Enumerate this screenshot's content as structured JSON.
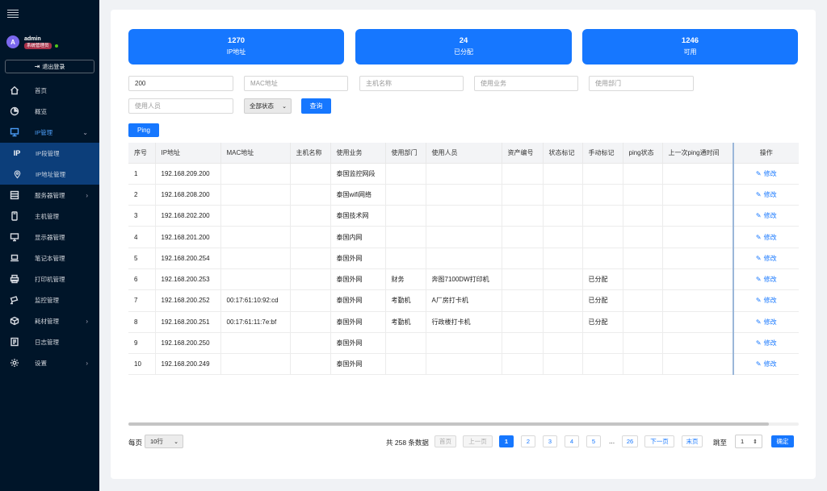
{
  "sidebar": {
    "user": {
      "initial": "A",
      "name": "admin",
      "role": "系统管理员"
    },
    "logout_label": "退出登录",
    "items": [
      {
        "label": "首页",
        "icon": "home-icon"
      },
      {
        "label": "概览",
        "icon": "pie-chart-icon"
      },
      {
        "label": "IP管理",
        "icon": "monitor-network-icon",
        "open": true,
        "children": [
          {
            "label": "IP段管理",
            "icon": "ip-icon"
          },
          {
            "label": "IP地址管理",
            "icon": "location-pin-icon"
          }
        ]
      },
      {
        "label": "服务器管理",
        "icon": "server-icon",
        "has_children": true
      },
      {
        "label": "主机管理",
        "icon": "desktop-tower-icon"
      },
      {
        "label": "显示器管理",
        "icon": "display-icon"
      },
      {
        "label": "笔记本管理",
        "icon": "laptop-icon"
      },
      {
        "label": "打印机管理",
        "icon": "printer-icon"
      },
      {
        "label": "监控管理",
        "icon": "camera-icon"
      },
      {
        "label": "耗材管理",
        "icon": "box-icon",
        "has_children": true
      },
      {
        "label": "日志管理",
        "icon": "log-icon"
      },
      {
        "label": "设置",
        "icon": "gear-icon",
        "has_children": true
      }
    ]
  },
  "stats": [
    {
      "value": "1270",
      "label": "IP地址"
    },
    {
      "value": "24",
      "label": "已分配"
    },
    {
      "value": "1246",
      "label": "可用"
    }
  ],
  "filters": {
    "ip_value": "200",
    "ip_placeholder": "IP地址",
    "mac_placeholder": "MAC地址",
    "host_placeholder": "主机名称",
    "business_placeholder": "使用业务",
    "dept_placeholder": "使用部门",
    "user_placeholder": "使用人员",
    "status_selected": "全部状态",
    "query_label": "查询",
    "ping_label": "Ping"
  },
  "table": {
    "columns": [
      "序号",
      "IP地址",
      "MAC地址",
      "主机名称",
      "使用业务",
      "使用部门",
      "使用人员",
      "资产编号",
      "状态标记",
      "手动标记",
      "ping状态",
      "上一次ping通时间",
      "操作"
    ],
    "edit_label": "修改",
    "rows": [
      [
        "1",
        "192.168.209.200",
        "",
        "",
        "泰国监控网段",
        "",
        "",
        "",
        "",
        "",
        "",
        ""
      ],
      [
        "2",
        "192.168.208.200",
        "",
        "",
        "泰国wifi网络",
        "",
        "",
        "",
        "",
        "",
        "",
        ""
      ],
      [
        "3",
        "192.168.202.200",
        "",
        "",
        "泰国技术网",
        "",
        "",
        "",
        "",
        "",
        "",
        ""
      ],
      [
        "4",
        "192.168.201.200",
        "",
        "",
        "泰国内网",
        "",
        "",
        "",
        "",
        "",
        "",
        ""
      ],
      [
        "5",
        "192.168.200.254",
        "",
        "",
        "泰国外网",
        "",
        "",
        "",
        "",
        "",
        "",
        ""
      ],
      [
        "6",
        "192.168.200.253",
        "",
        "",
        "泰国外网",
        "财务",
        "奔图7100DW打印机",
        "",
        "",
        "已分配",
        "",
        ""
      ],
      [
        "7",
        "192.168.200.252",
        "00:17:61:10:92:cd",
        "",
        "泰国外网",
        "考勤机",
        "A厂房打卡机",
        "",
        "",
        "已分配",
        "",
        ""
      ],
      [
        "8",
        "192.168.200.251",
        "00:17:61:11:7e:bf",
        "",
        "泰国外网",
        "考勤机",
        "行政楼打卡机",
        "",
        "",
        "已分配",
        "",
        ""
      ],
      [
        "9",
        "192.168.200.250",
        "",
        "",
        "泰国外网",
        "",
        "",
        "",
        "",
        "",
        "",
        ""
      ],
      [
        "10",
        "192.168.200.249",
        "",
        "",
        "泰国外网",
        "",
        "",
        "",
        "",
        "",
        "",
        ""
      ]
    ]
  },
  "pagination": {
    "per_page_label": "每页",
    "per_page_value": "10行",
    "total_text": "共 258 条数据",
    "first": "首页",
    "prev": "上一页",
    "pages": [
      "1",
      "2",
      "3",
      "4",
      "5"
    ],
    "ellipsis": "...",
    "last_page": "26",
    "next": "下一页",
    "last": "末页",
    "jump_label": "跳至",
    "jump_value": "1",
    "confirm": "确定"
  },
  "colors": {
    "accent": "#1677ff",
    "sidebar_bg": "#001529",
    "submenu_bg": "#0c3e7a"
  }
}
